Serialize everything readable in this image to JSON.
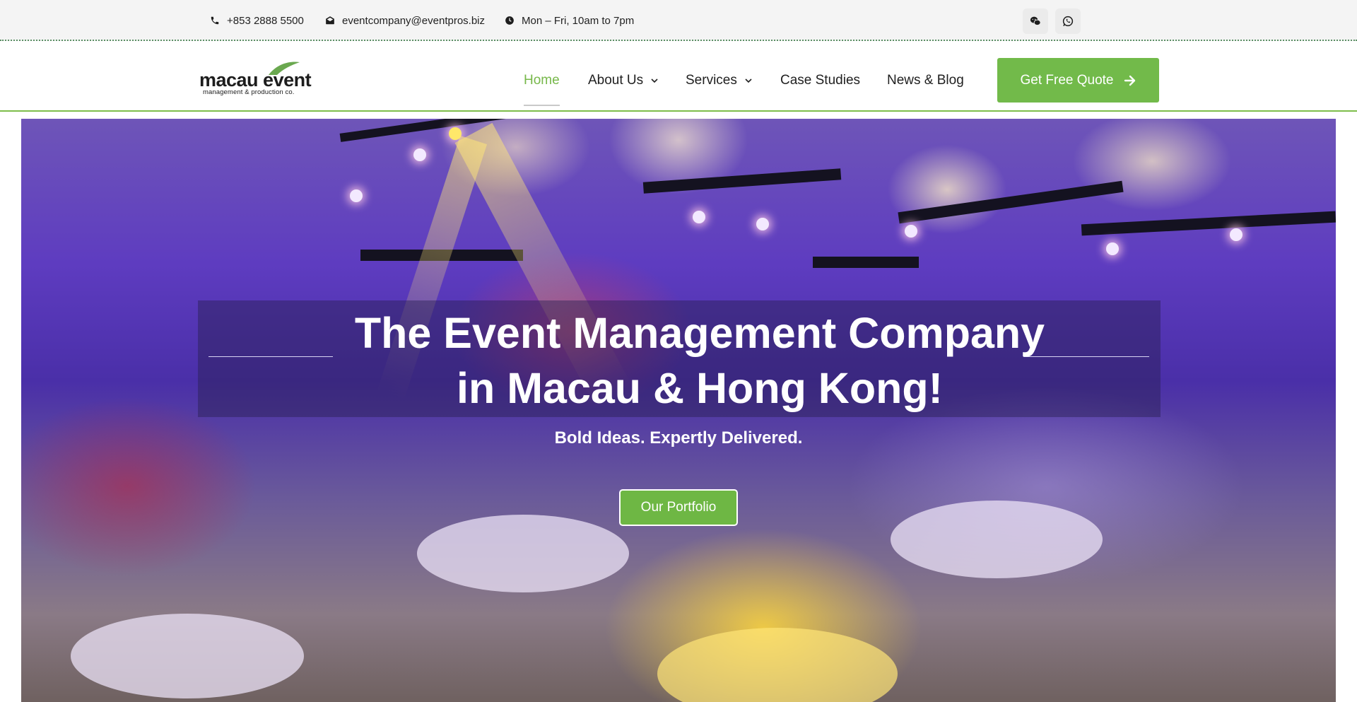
{
  "topbar": {
    "phone": "+853 2888 5500",
    "email": "eventcompany@eventpros.biz",
    "hours": "Mon – Fri, 10am to 7pm",
    "social_icons": [
      "wechat-icon",
      "whatsapp-icon"
    ]
  },
  "logo": {
    "main": "macau event",
    "sub": "management & production co."
  },
  "nav": {
    "items": [
      {
        "label": "Home",
        "active": true
      },
      {
        "label": "About Us",
        "dropdown": true
      },
      {
        "label": "Services",
        "dropdown": true
      },
      {
        "label": "Case Studies"
      },
      {
        "label": "News & Blog"
      }
    ],
    "cta_label": "Get Free Quote"
  },
  "hero": {
    "title_line1": "The Event Management Company",
    "title_line2": "in Macau & Hong Kong!",
    "subtitle": "Bold Ideas. Expertly Delivered.",
    "button_label": "Our Portfolio"
  },
  "colors": {
    "accent": "#72ba4a",
    "topbar_bg": "#f4f4f4",
    "text": "#1f1f1f"
  }
}
